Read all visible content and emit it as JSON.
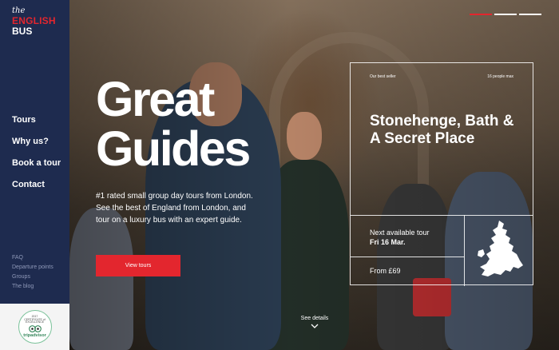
{
  "logo": {
    "the": "the",
    "english": "ENGLISH",
    "bus": "BUS"
  },
  "nav": {
    "main": [
      "Tours",
      "Why us?",
      "Book a tour",
      "Contact"
    ],
    "sub": [
      "FAQ",
      "Departure points",
      "Groups",
      "The blog"
    ]
  },
  "tripadvisor": {
    "line1": "2017",
    "line2": "CERTIFICATE of",
    "line3": "EXCELLENCE",
    "brand": "tripadvisor"
  },
  "hero": {
    "title_line1": "Great",
    "title_line2": "Guides",
    "description": "#1 rated small group day tours from London. See the best of England from London, and tour on a luxury bus with an expert guide.",
    "cta": "View tours",
    "see_details": "See details",
    "slides": {
      "count": 3,
      "active_index": 0
    }
  },
  "tour_card": {
    "badge_left": "Our best seller",
    "badge_right": "16 people max",
    "title": "Stonehenge, Bath & A Secret Place",
    "next_label": "Next available tour",
    "next_date": "Fri 16 Mar.",
    "price": "From £69"
  },
  "colors": {
    "brand_navy": "#1e2b4f",
    "accent_red": "#e3262e",
    "tripadvisor_green": "#34855a"
  }
}
